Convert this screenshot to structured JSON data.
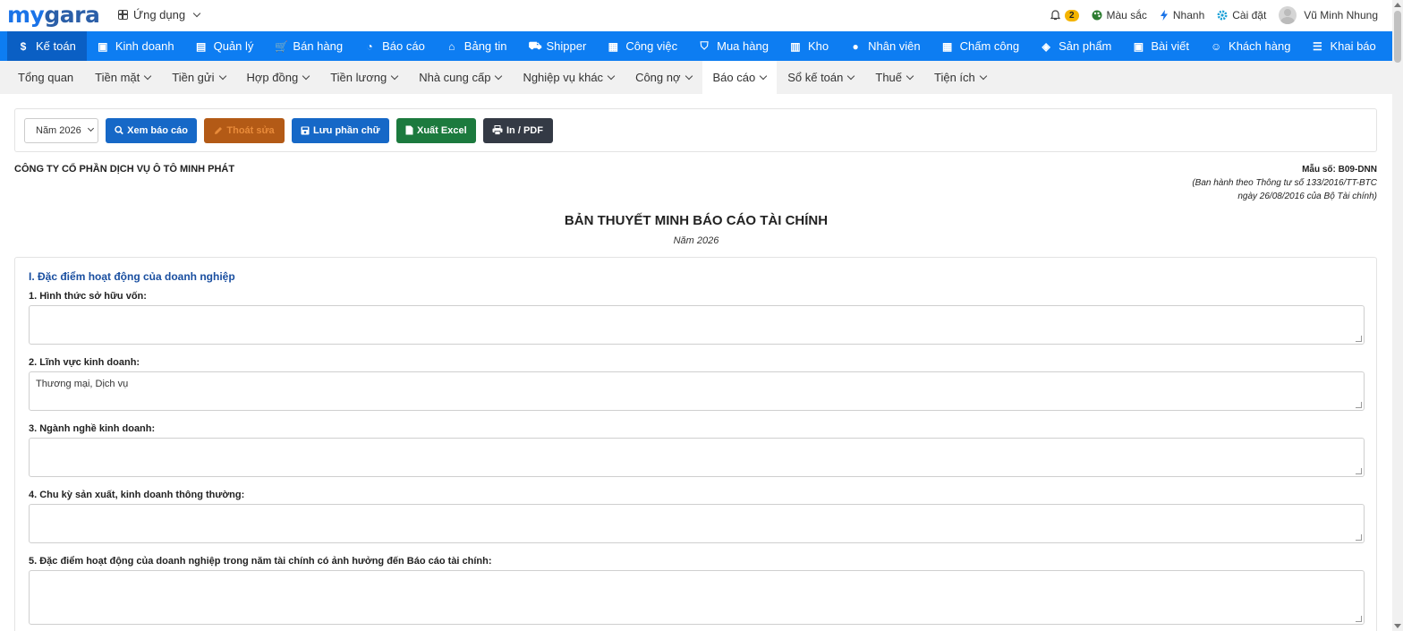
{
  "header": {
    "logo_part1": "my",
    "logo_part2": "gara",
    "apps_label": "Ứng dụng",
    "notification_count": "2",
    "color_label": "Màu sắc",
    "quick_label": "Nhanh",
    "settings_label": "Cài đặt",
    "user_name": "Vũ Minh Nhung"
  },
  "main_nav": [
    {
      "label": "Kế toán",
      "icon": "$",
      "active": true
    },
    {
      "label": "Kinh doanh",
      "icon": "▣"
    },
    {
      "label": "Quản lý",
      "icon": "▤"
    },
    {
      "label": "Bán hàng",
      "icon": "🛒"
    },
    {
      "label": "Báo cáo",
      "icon": "◔"
    },
    {
      "label": "Bảng tin",
      "icon": "⌂"
    },
    {
      "label": "Shipper",
      "icon": "⛟"
    },
    {
      "label": "Công việc",
      "icon": "▦"
    },
    {
      "label": "Mua hàng",
      "icon": "⛉"
    },
    {
      "label": "Kho",
      "icon": "▥"
    },
    {
      "label": "Nhân viên",
      "icon": "●"
    },
    {
      "label": "Chấm công",
      "icon": "▦"
    },
    {
      "label": "Sản phẩm",
      "icon": "◈"
    },
    {
      "label": "Bài viết",
      "icon": "▣"
    },
    {
      "label": "Khách hàng",
      "icon": "☺"
    },
    {
      "label": "Khai báo",
      "icon": "☰"
    }
  ],
  "sub_nav": [
    {
      "label": "Tổng quan",
      "dropdown": false
    },
    {
      "label": "Tiền mặt",
      "dropdown": true
    },
    {
      "label": "Tiền gửi",
      "dropdown": true
    },
    {
      "label": "Hợp đồng",
      "dropdown": true
    },
    {
      "label": "Tiền lương",
      "dropdown": true
    },
    {
      "label": "Nhà cung cấp",
      "dropdown": true
    },
    {
      "label": "Nghiệp vụ khác",
      "dropdown": true
    },
    {
      "label": "Công nợ",
      "dropdown": true
    },
    {
      "label": "Báo cáo",
      "dropdown": true,
      "active": true
    },
    {
      "label": "Sổ kế toán",
      "dropdown": true
    },
    {
      "label": "Thuế",
      "dropdown": true
    },
    {
      "label": "Tiện ích",
      "dropdown": true
    }
  ],
  "toolbar": {
    "year_select": "Năm 2026",
    "view_report": "Xem báo cáo",
    "exit_edit": "Thoát sửa",
    "save_text": "Lưu phần chữ",
    "export_excel": "Xuất Excel",
    "print_pdf": "In / PDF"
  },
  "document": {
    "company": "CÔNG TY CỔ PHẦN DỊCH VỤ Ô TÔ MINH PHÁT",
    "form_no": "Mẫu số: B09-DNN",
    "issued_by": "(Ban hành theo Thông tư số 133/2016/TT-BTC",
    "issued_date": "ngày 26/08/2016 của Bộ Tài chính)",
    "title": "BẢN THUYẾT MINH BÁO CÁO TÀI CHÍNH",
    "year": "Năm 2026"
  },
  "section1": {
    "title": "I. Đặc điểm hoạt động của doanh nghiệp",
    "fields": [
      {
        "label": "1. Hình thức sở hữu vốn:",
        "value": ""
      },
      {
        "label": "2. Lĩnh vực kinh doanh:",
        "value": "Thương mại, Dịch vụ"
      },
      {
        "label": "3. Ngành nghề kinh doanh:",
        "value": ""
      },
      {
        "label": "4. Chu kỳ sản xuất, kinh doanh thông thường:",
        "value": ""
      },
      {
        "label": "5. Đặc điểm hoạt động của doanh nghiệp trong năm tài chính có ảnh hưởng đến Báo cáo tài chính:",
        "value": ""
      }
    ]
  }
}
